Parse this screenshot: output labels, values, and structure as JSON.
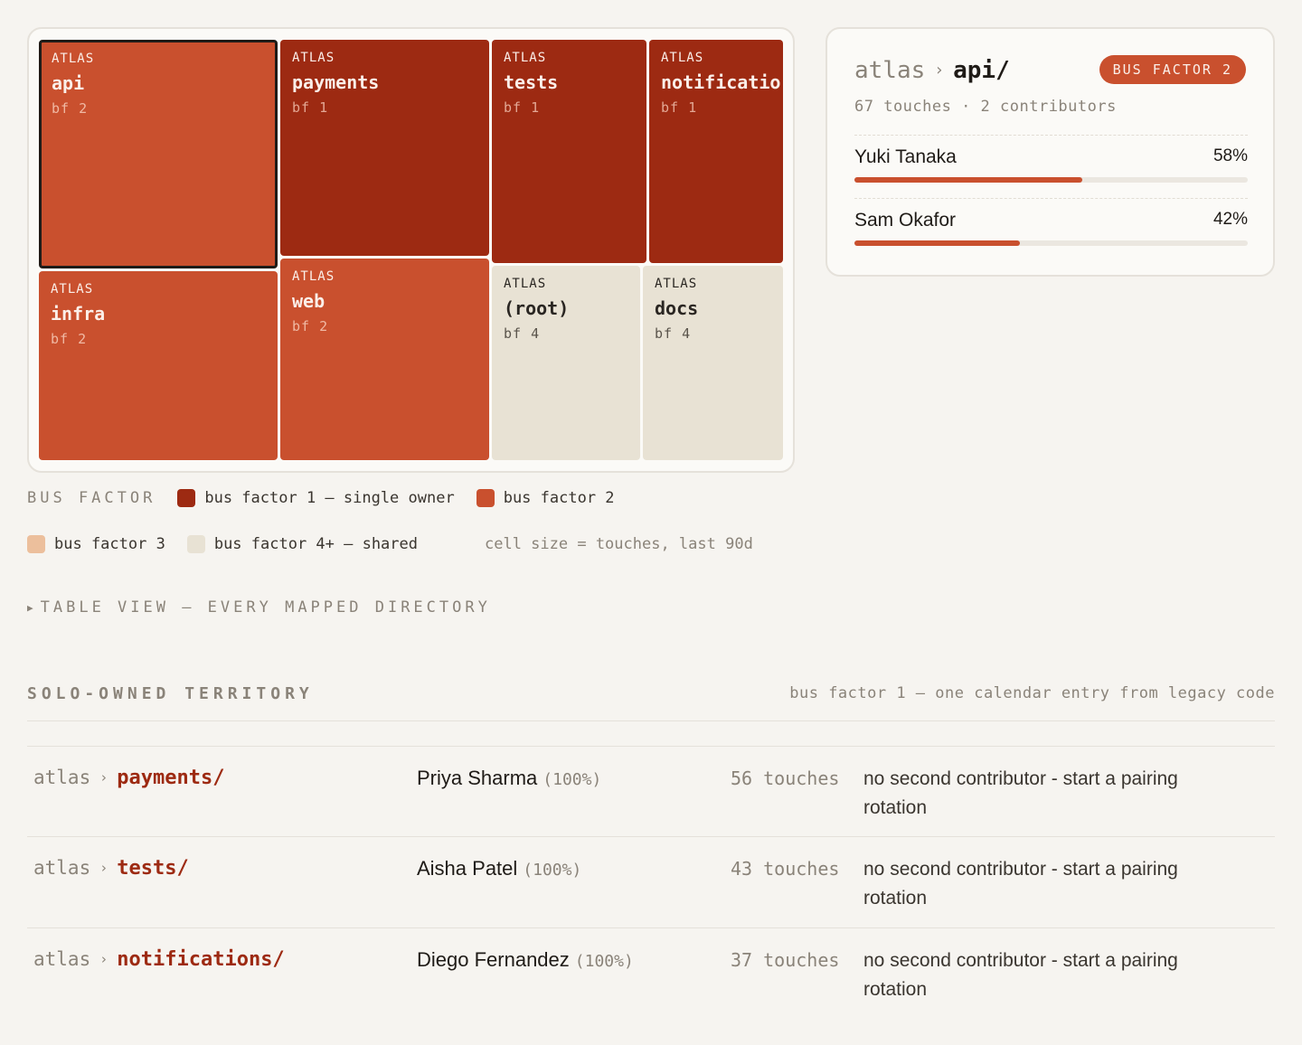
{
  "treemap": {
    "cells": [
      {
        "project": "ATLAS",
        "name": "api",
        "bf": "bf 2",
        "bus_factor": 2,
        "selected": true
      },
      {
        "project": "ATLAS",
        "name": "payments",
        "bf": "bf 1",
        "bus_factor": 1
      },
      {
        "project": "ATLAS",
        "name": "tests",
        "bf": "bf 1",
        "bus_factor": 1
      },
      {
        "project": "ATLAS",
        "name": "notificatio",
        "bf": "bf 1",
        "bus_factor": 1
      },
      {
        "project": "ATLAS",
        "name": "infra",
        "bf": "bf 2",
        "bus_factor": 2
      },
      {
        "project": "ATLAS",
        "name": "web",
        "bf": "bf 2",
        "bus_factor": 2
      },
      {
        "project": "ATLAS",
        "name": "(root)",
        "bf": "bf 4",
        "bus_factor": 4
      },
      {
        "project": "ATLAS",
        "name": "docs",
        "bf": "bf 4",
        "bus_factor": 4
      }
    ]
  },
  "detail": {
    "project": "atlas",
    "separator": "›",
    "dir": "api/",
    "badge": "BUS FACTOR 2",
    "meta": "67 touches · 2 contributors",
    "contributors": [
      {
        "name": "Yuki Tanaka",
        "pct": "58%",
        "share": 0.58
      },
      {
        "name": "Sam Okafor",
        "pct": "42%",
        "share": 0.42
      }
    ]
  },
  "legend": {
    "heading": "BUS FACTOR",
    "items": [
      {
        "label": "bus factor 1 — single owner",
        "color": "#9d2a12"
      },
      {
        "label": "bus factor 2",
        "color": "#c9502e"
      },
      {
        "label": "bus factor 3",
        "color": "#ecbf9c"
      },
      {
        "label": "bus factor 4+ — shared",
        "color": "#e8e2d4"
      }
    ],
    "note": "cell size = touches, last 90d"
  },
  "table_toggle": {
    "icon": "triangle-right-icon",
    "label": "TABLE VIEW — EVERY MAPPED DIRECTORY"
  },
  "solo": {
    "heading": "SOLO-OWNED TERRITORY",
    "subheading": "bus factor 1 — one calendar entry from legacy code",
    "rows": [
      {
        "project": "atlas",
        "sep": "›",
        "dir": "payments/",
        "owner": "Priya Sharma",
        "pct": "(100%)",
        "touches": "56 touches",
        "advice": "no second contributor - start a pairing rotation"
      },
      {
        "project": "atlas",
        "sep": "›",
        "dir": "tests/",
        "owner": "Aisha Patel",
        "pct": "(100%)",
        "touches": "43 touches",
        "advice": "no second contributor - start a pairing rotation"
      },
      {
        "project": "atlas",
        "sep": "›",
        "dir": "notifications/",
        "owner": "Diego Fernandez",
        "pct": "(100%)",
        "touches": "37 touches",
        "advice": "no second contributor - start a pairing rotation"
      }
    ]
  }
}
